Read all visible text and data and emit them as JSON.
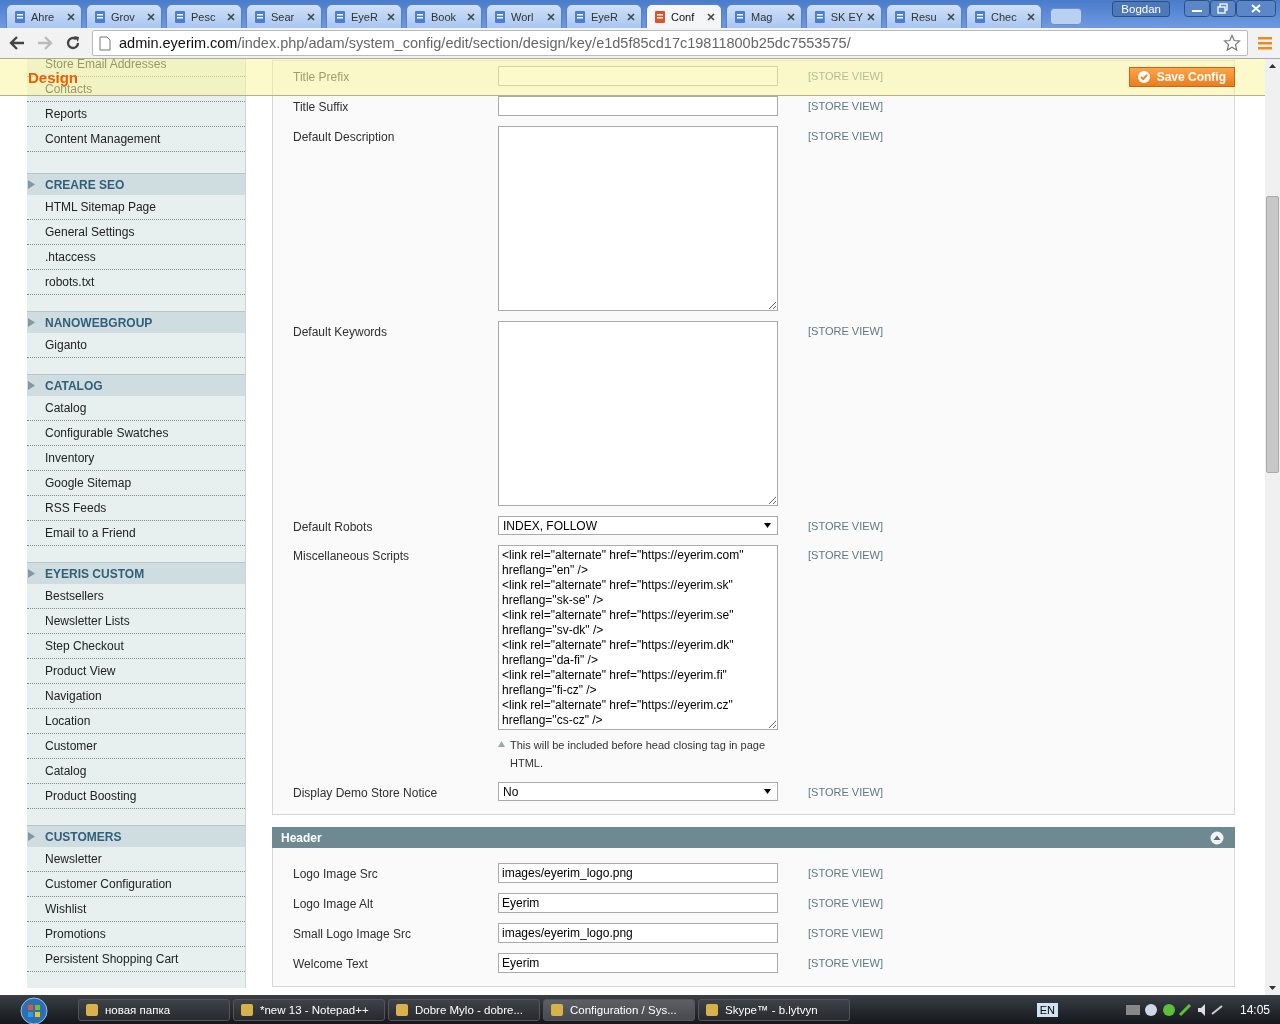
{
  "browser": {
    "tabs": [
      {
        "label": "Ahre",
        "selected": false
      },
      {
        "label": "Grov",
        "selected": false
      },
      {
        "label": "Pesc",
        "selected": false
      },
      {
        "label": "Sear",
        "selected": false
      },
      {
        "label": "EyeR",
        "selected": false
      },
      {
        "label": "Book",
        "selected": false
      },
      {
        "label": "Worl",
        "selected": false
      },
      {
        "label": "EyeR",
        "selected": false
      },
      {
        "label": "Conf",
        "selected": true
      },
      {
        "label": "Mag",
        "selected": false
      },
      {
        "label": "SK EY",
        "selected": false
      },
      {
        "label": "Resu",
        "selected": false
      },
      {
        "label": "Chec",
        "selected": false
      }
    ],
    "profile": "Bogdan",
    "url": {
      "host": "admin.eyerim.com",
      "path": "/index.php/adam/system_config/edit/section/design/key/e1d5f85cd17c19811800b25dc7553575/"
    }
  },
  "page": {
    "title": "Design",
    "save_button": "Save Config"
  },
  "sidebar": {
    "sections": [
      {
        "items": [
          "Store Email Addresses",
          "Contacts",
          "Reports",
          "Content Management"
        ]
      },
      {
        "title": "CREARE SEO",
        "items": [
          "HTML Sitemap Page",
          "General Settings",
          ".htaccess",
          "robots.txt"
        ]
      },
      {
        "title": "NANOWEBGROUP",
        "items": [
          "Giganto"
        ]
      },
      {
        "title": "CATALOG",
        "items": [
          "Catalog",
          "Configurable Swatches",
          "Inventory",
          "Google Sitemap",
          "RSS Feeds",
          "Email to a Friend"
        ]
      },
      {
        "title": "EYERIS CUSTOM",
        "items": [
          "Bestsellers",
          "Newsletter Lists",
          "Step Checkout",
          "Product View",
          "Navigation",
          "Location",
          "Customer",
          "Catalog",
          "Product Boosting"
        ]
      },
      {
        "title": "CUSTOMERS",
        "items": [
          "Newsletter",
          "Customer Configuration",
          "Wishlist",
          "Promotions",
          "Persistent Shopping Cart"
        ]
      }
    ]
  },
  "fields": [
    {
      "label": "Title Prefix",
      "kind": "text",
      "scope": "[STORE VIEW]"
    },
    {
      "label": "Title Suffix",
      "kind": "text",
      "scope": "[STORE VIEW]"
    },
    {
      "label": "Default Description",
      "kind": "textarea",
      "scope": "[STORE VIEW]"
    },
    {
      "label": "Default Keywords",
      "kind": "textarea",
      "scope": "[STORE VIEW]"
    },
    {
      "label": "Default Robots",
      "kind": "select",
      "value": "INDEX, FOLLOW",
      "scope": "[STORE VIEW]"
    },
    {
      "label": "Miscellaneous Scripts",
      "kind": "textarea",
      "value": "<link rel=\"alternate\" href=\"https://eyerim.com\" hreflang=\"en\" />\n<link rel=\"alternate\" href=\"https://eyerim.sk\" hreflang=\"sk-se\" />\n<link rel=\"alternate\" href=\"https://eyerim.se\" hreflang=\"sv-dk\" />\n<link rel=\"alternate\" href=\"https://eyerim.dk\" hreflang=\"da-fi\" />\n<link rel=\"alternate\" href=\"https://eyerim.fi\" hreflang=\"fi-cz\" />\n<link rel=\"alternate\" href=\"https://eyerim.cz\" hreflang=\"cs-cz\" />",
      "note": "This will be included before head closing tag in page HTML.",
      "scope": "[STORE VIEW]"
    },
    {
      "label": "Display Demo Store Notice",
      "kind": "select",
      "value": "No",
      "scope": "[STORE VIEW]"
    }
  ],
  "header_section": {
    "title": "Header",
    "expanded": true,
    "fields": [
      {
        "label": "Logo Image Src",
        "kind": "text",
        "value": "images/eyerim_logo.png",
        "scope": "[STORE VIEW]"
      },
      {
        "label": "Logo Image Alt",
        "kind": "text",
        "value": "Eyerim",
        "scope": "[STORE VIEW]"
      },
      {
        "label": "Small Logo Image Src",
        "kind": "text",
        "value": "images/eyerim_logo.png",
        "scope": "[STORE VIEW]"
      },
      {
        "label": "Welcome Text",
        "kind": "text",
        "value": "Eyerim",
        "scope": "[STORE VIEW]"
      }
    ]
  },
  "taskbar": {
    "items": [
      {
        "label": "новая папка",
        "selected": false
      },
      {
        "label": "*new  13 - Notepad++",
        "selected": false
      },
      {
        "label": "Dobre Mylo - dobre...",
        "selected": false
      },
      {
        "label": "Configuration / Sys...",
        "selected": true
      },
      {
        "label": "Skype™ - b.lytvyn",
        "selected": false
      }
    ],
    "language": "EN",
    "time": "14:05"
  }
}
